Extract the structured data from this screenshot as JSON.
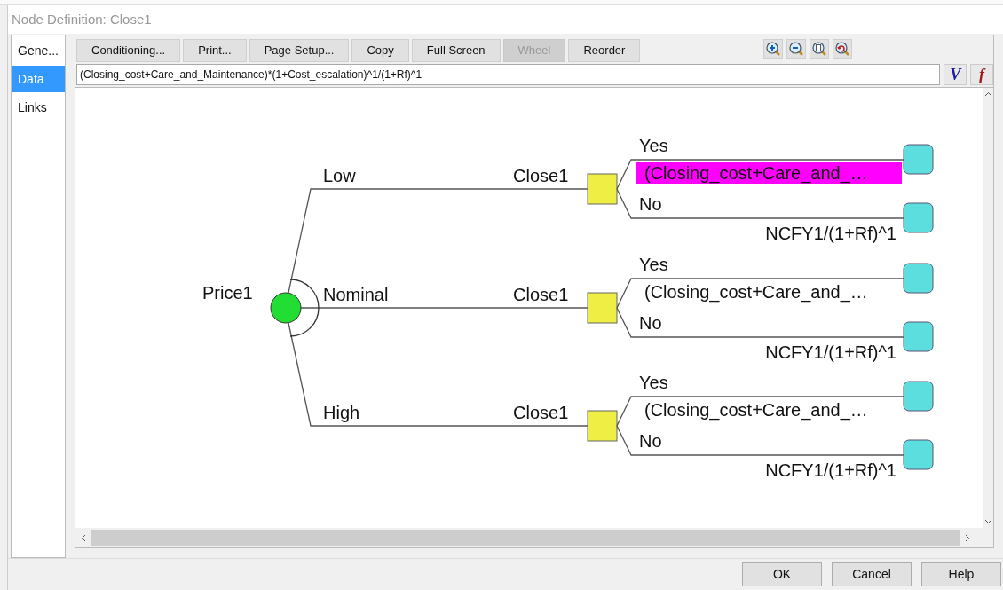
{
  "window": {
    "title": "Node Definition: Close1"
  },
  "sidebar": {
    "items": [
      {
        "label": "Gene...",
        "selected": false
      },
      {
        "label": "Data",
        "selected": true
      },
      {
        "label": "Links",
        "selected": false
      }
    ]
  },
  "toolbar": {
    "buttons": [
      {
        "label": "Conditioning...",
        "disabled": false
      },
      {
        "label": "Print...",
        "disabled": false
      },
      {
        "label": "Page Setup...",
        "disabled": false
      },
      {
        "label": "Copy",
        "disabled": false
      },
      {
        "label": "Full Screen",
        "disabled": false
      },
      {
        "label": "Wheel",
        "disabled": true
      },
      {
        "label": "Reorder",
        "disabled": false
      }
    ],
    "zoom_tools": [
      {
        "kind": "zoom-in"
      },
      {
        "kind": "zoom-out"
      },
      {
        "kind": "zoom-page"
      },
      {
        "kind": "zoom-reset"
      }
    ]
  },
  "formula": {
    "value": "(Closing_cost+Care_and_Maintenance)*(1+Cost_escalation)^1/(1+Rf)^1",
    "v_button": "V",
    "f_button": "f"
  },
  "tree": {
    "root": "Price1",
    "branches": [
      {
        "label": "Low",
        "node": "Close1",
        "outcomes": [
          {
            "label": "Yes",
            "value": "(Closing_cost+Care_and_…",
            "selected": true
          },
          {
            "label": "No",
            "value": "NCFY1/(1+Rf)^1",
            "selected": false
          }
        ]
      },
      {
        "label": "Nominal",
        "node": "Close1",
        "outcomes": [
          {
            "label": "Yes",
            "value": "(Closing_cost+Care_and_…",
            "selected": false
          },
          {
            "label": "No",
            "value": "NCFY1/(1+Rf)^1",
            "selected": false
          }
        ]
      },
      {
        "label": "High",
        "node": "Close1",
        "outcomes": [
          {
            "label": "Yes",
            "value": "(Closing_cost+Care_and_…",
            "selected": false
          },
          {
            "label": "No",
            "value": "NCFY1/(1+Rf)^1",
            "selected": false
          }
        ]
      }
    ]
  },
  "buttons": [
    "OK",
    "Cancel",
    "Help"
  ]
}
